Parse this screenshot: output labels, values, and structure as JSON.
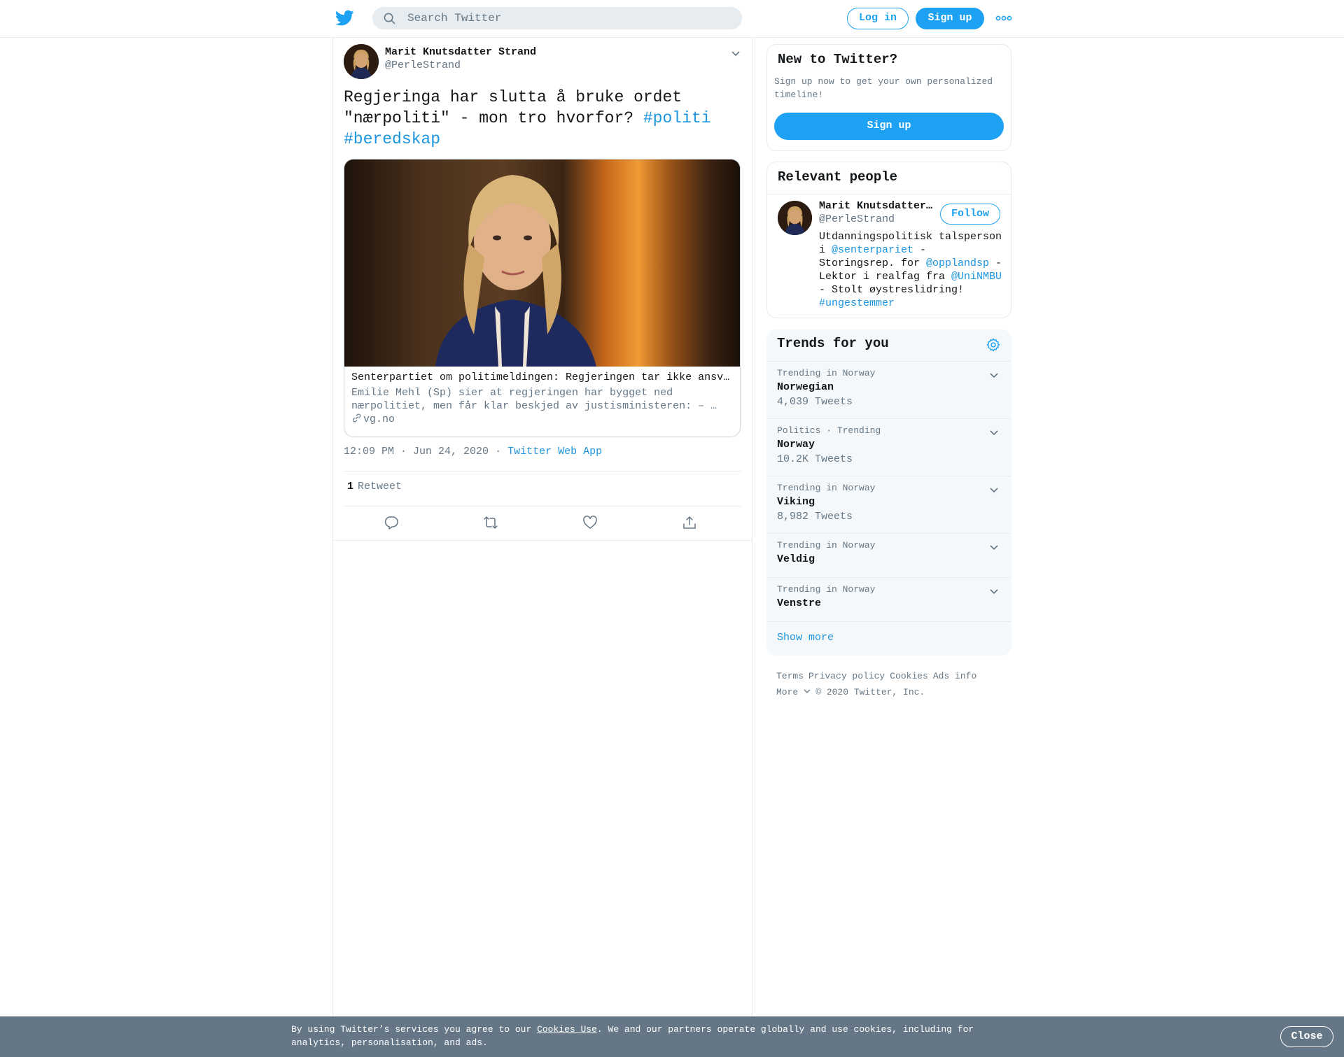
{
  "header": {
    "search_placeholder": "Search Twitter",
    "login_label": "Log in",
    "signup_label": "Sign up"
  },
  "tweet": {
    "author_name": "Marit Knutsdatter Strand",
    "author_handle": "@PerleStrand",
    "text_main": "Regjeringa har slutta å bruke ordet \"nærpoliti\" - mon tro hvorfor? ",
    "hashtag_1": "#politi",
    "hashtag_2": "#beredskap",
    "card": {
      "title": "Senterpartiet om politimeldingen: Regjeringen tar ikke ansvar for nærpolitiet",
      "description": "Emilie Mehl (Sp) sier at regjeringen har bygget ned nærpolitiet, men får klar beskjed av justisministeren: – …",
      "domain": "vg.no"
    },
    "time": "12:09 PM · Jun 24, 2020",
    "dot": "·",
    "source": "Twitter Web App",
    "retweet_count": "1",
    "retweet_label": "Retweet"
  },
  "sidebar": {
    "new_to_twitter": {
      "title": "New to Twitter?",
      "subtitle": "Sign up now to get your own personalized timeline!",
      "button": "Sign up"
    },
    "relevant_people": {
      "title": "Relevant people",
      "name": "Marit Knutsdatter Strand",
      "handle": "@PerleStrand",
      "follow_label": "Follow",
      "bio": {
        "p1": "Utdanningspolitisk talsperson i ",
        "m1": "@senterpariet",
        "p2": " - Storingsrep. for ",
        "m2": "@opplandsp",
        "p3": " - Lektor i realfag fra ",
        "m3": "@UniNMBU",
        "p4": " - Stolt øystreslidring! ",
        "m4": "#ungestemmer"
      }
    },
    "trends": {
      "title": "Trends for you",
      "items": [
        {
          "context": "Trending in Norway",
          "name": "Norwegian",
          "count": "4,039 Tweets"
        },
        {
          "context": "Politics · Trending",
          "name": "Norway",
          "count": "10.2K Tweets"
        },
        {
          "context": "Trending in Norway",
          "name": "Viking",
          "count": "8,982 Tweets"
        },
        {
          "context": "Trending in Norway",
          "name": "Veldig",
          "count": ""
        },
        {
          "context": "Trending in Norway",
          "name": "Venstre",
          "count": ""
        }
      ],
      "show_more": "Show more"
    },
    "footer": {
      "terms": "Terms",
      "privacy": "Privacy policy",
      "cookies": "Cookies",
      "ads": "Ads info",
      "more": "More",
      "copyright": "© 2020 Twitter, Inc."
    }
  },
  "cookie_bar": {
    "text_before": "By using Twitter’s services you agree to our ",
    "link": "Cookies Use",
    "text_after": ". We and our partners operate globally and use cookies, including for analytics, personalisation, and ads.",
    "close_label": "Close"
  },
  "colors": {
    "accent": "#1da1f2",
    "link": "#1b95e0",
    "secondary_text": "#657786",
    "cookie_bg": "#657786"
  }
}
